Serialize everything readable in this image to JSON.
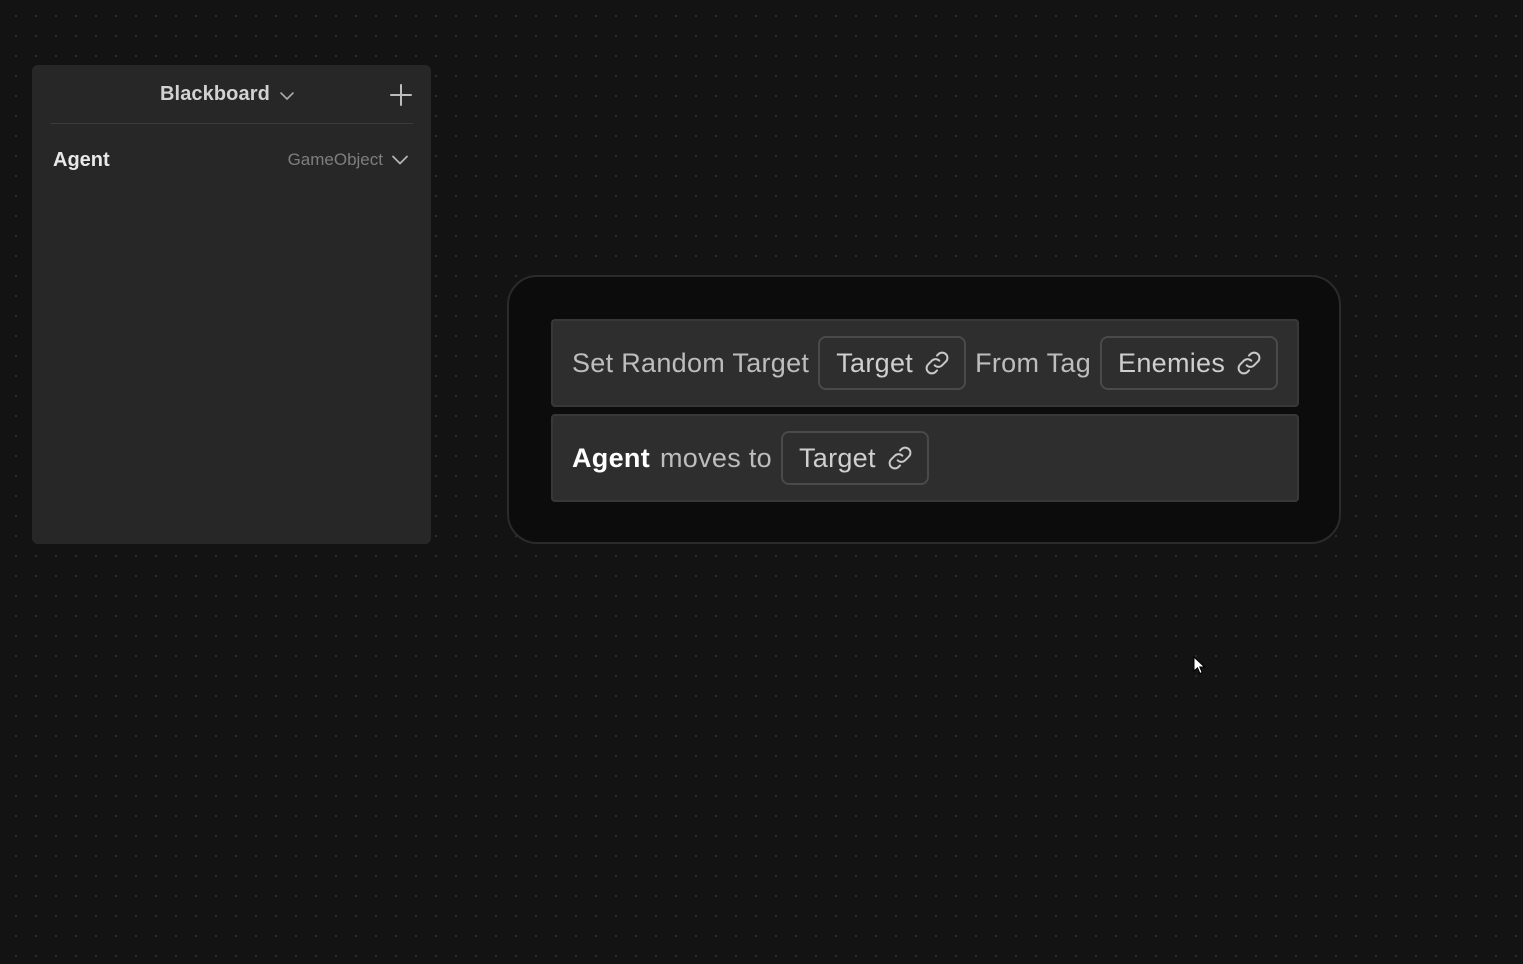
{
  "blackboard": {
    "title": "Blackboard",
    "add_icon": "plus-icon",
    "title_icon": "chevron-down-icon",
    "variables": [
      {
        "name": "Agent",
        "type": "GameObject",
        "type_icon": "chevron-down-icon"
      }
    ]
  },
  "sequence": {
    "actions": [
      {
        "prefix": "Set Random Target",
        "field1": "Target",
        "middle": "From Tag",
        "field2": "Enemies",
        "field_icon": "link-icon"
      },
      {
        "subject": "Agent",
        "verb": "moves to",
        "field1": "Target",
        "field_icon": "link-icon"
      }
    ]
  },
  "colors": {
    "canvas": "#131313",
    "panel": "#272727",
    "node": "#0c0c0c",
    "action": "#2e2e2e",
    "accent_text": "#ffffff"
  }
}
